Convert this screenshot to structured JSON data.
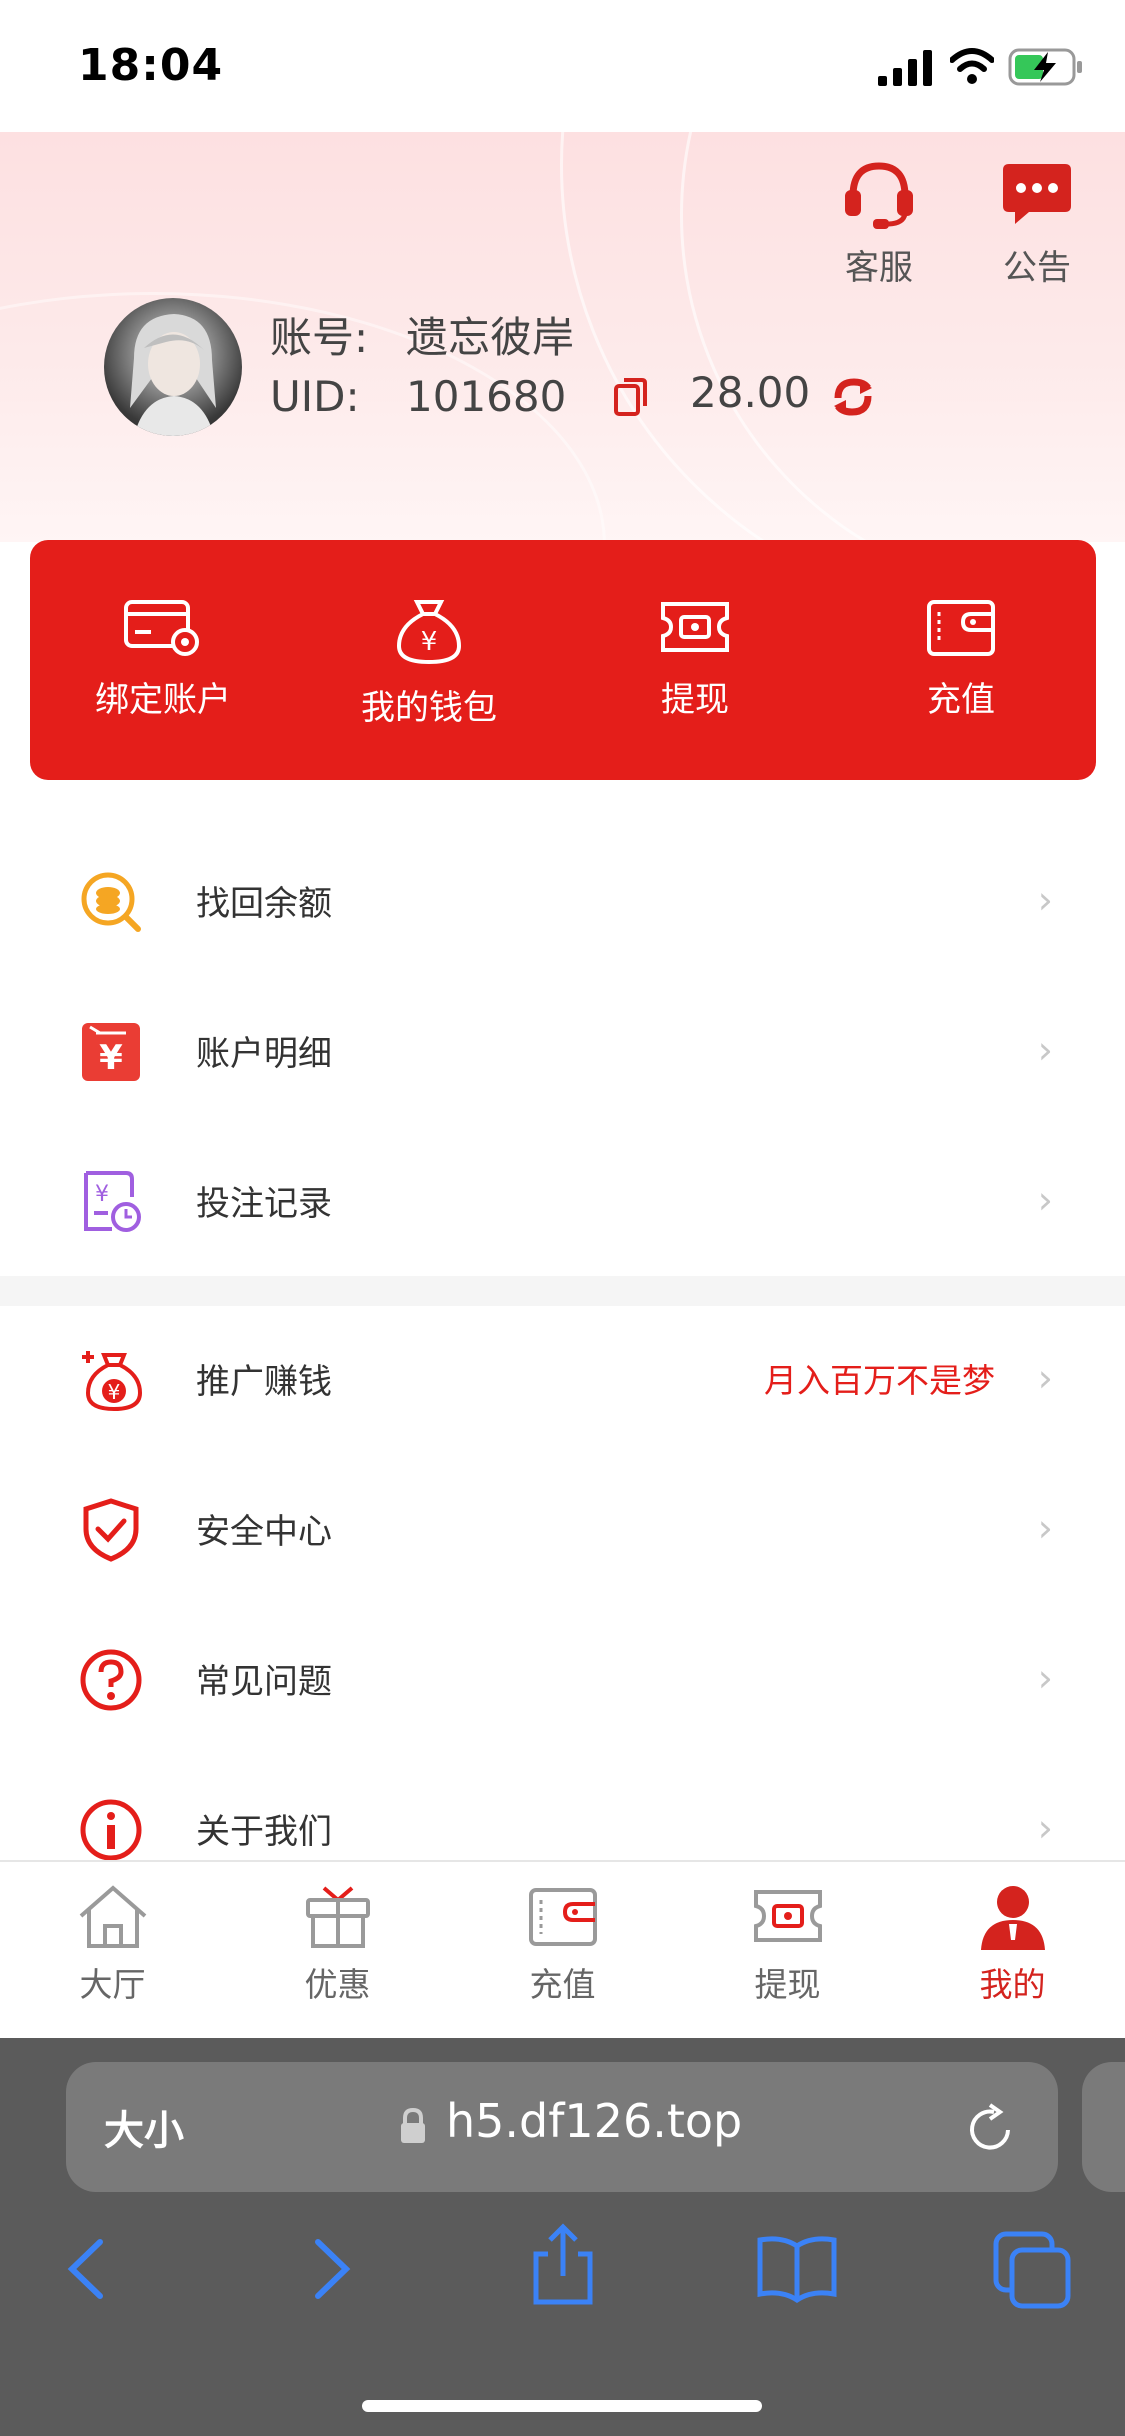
{
  "status_bar": {
    "time": "18:04"
  },
  "header": {
    "customer_service_label": "客服",
    "notice_label": "公告",
    "account_label": "账号:",
    "account_name": "遗忘彼岸",
    "uid_label": "UID:",
    "uid_value": "101680",
    "balance": "28.00"
  },
  "quick_actions": [
    {
      "label": "绑定账户",
      "icon": "card-settings-icon"
    },
    {
      "label": "我的钱包",
      "icon": "money-bag-icon"
    },
    {
      "label": "提现",
      "icon": "ticket-cash-icon"
    },
    {
      "label": "充值",
      "icon": "wallet-icon"
    }
  ],
  "menu_group_1": [
    {
      "label": "找回余额",
      "icon": "coin-search-icon"
    },
    {
      "label": "账户明细",
      "icon": "ledger-icon"
    },
    {
      "label": "投注记录",
      "icon": "bet-record-icon"
    }
  ],
  "menu_group_2": [
    {
      "label": "推广赚钱",
      "icon": "money-bag-plus-icon",
      "promo": "月入百万不是梦"
    },
    {
      "label": "安全中心",
      "icon": "shield-check-icon"
    },
    {
      "label": "常见问题",
      "icon": "question-icon"
    },
    {
      "label": "关于我们",
      "icon": "info-icon"
    }
  ],
  "tab_bar": [
    {
      "label": "大厅",
      "icon": "home-icon"
    },
    {
      "label": "优惠",
      "icon": "gift-icon"
    },
    {
      "label": "充值",
      "icon": "wallet-icon"
    },
    {
      "label": "提现",
      "icon": "ticket-cash-icon"
    },
    {
      "label": "我的",
      "icon": "user-icon",
      "active": true
    }
  ],
  "browser": {
    "text_size_label": "大小",
    "url": "h5.df126.top"
  },
  "colors": {
    "brand_red": "#e41e1a",
    "active_tab": "#d4231e",
    "ios_blue": "#3b82f6"
  }
}
